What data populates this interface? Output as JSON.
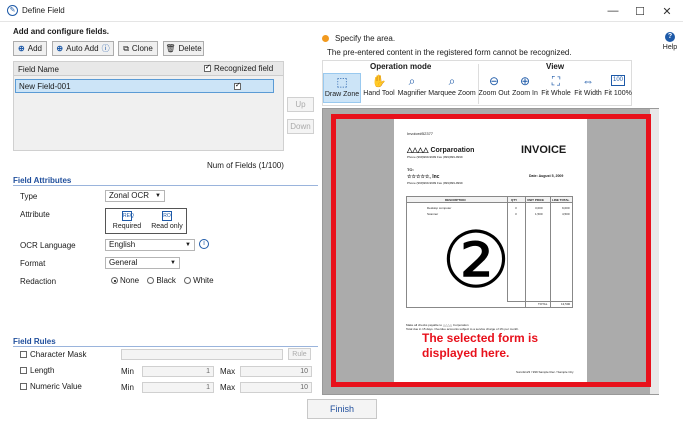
{
  "window": {
    "title": "Define Field"
  },
  "left": {
    "heading": "Add and configure fields.",
    "toolbar": {
      "add": "Add",
      "auto_add": "Auto Add",
      "clone": "Clone",
      "delete": "Delete"
    },
    "table": {
      "col_name": "Field Name",
      "col_recognized": "Recognized field",
      "rows": [
        {
          "name": "New Field-001",
          "recognized": true
        }
      ]
    },
    "up": "Up",
    "down": "Down",
    "num_fields": "Num of Fields (1/100)",
    "attributes": {
      "title": "Field Attributes",
      "type_label": "Type",
      "type_value": "Zonal OCR",
      "attribute_label": "Attribute",
      "required": "Required",
      "read_only": "Read only",
      "ocr_label": "OCR Language",
      "ocr_value": "English",
      "format_label": "Format",
      "format_value": "General",
      "redaction_label": "Redaction",
      "redaction_options": [
        "None",
        "Black",
        "White"
      ],
      "redaction_selected": "None"
    },
    "rules": {
      "title": "Field Rules",
      "character_mask": "Character Mask",
      "rule_button": "Rule",
      "length": "Length",
      "numeric_value": "Numeric Value",
      "min_label": "Min",
      "max_label": "Max",
      "length_min": "1",
      "length_max": "10",
      "numeric_min": "1",
      "numeric_max": "10"
    }
  },
  "right": {
    "info_title": "Specify the area.",
    "info_text": "The pre-entered content in the registered form cannot be recognized.",
    "help": "Help",
    "operation_mode": "Operation mode",
    "view": "View",
    "tools": [
      "Draw Zone",
      "Hand Tool",
      "Magnifier",
      "Marquee Zoom"
    ],
    "view_tools": [
      "Zoom Out",
      "Zoom In",
      "Fit Whole",
      "Fit Width",
      "Fit 100%"
    ],
    "invoice": {
      "number": "Invoice#52377",
      "company": "△△△△ Corparoation",
      "company_phone": "Phone (999)999-9999  Fax (999)999-9999",
      "title": "INVOICE",
      "to_label": "TO:",
      "customer": "☆☆☆☆☆, Inc",
      "customer_phone": "Phone (999)999-9999  Fax (999)999-9999",
      "date": "Date: August 5, 2009",
      "headers": [
        "DESCRIPTION",
        "QTY",
        "UNIT PRICE",
        "LINE TOTAL"
      ],
      "items": [
        [
          "Desktop computer",
          "3",
          "3,000",
          "9,000"
        ],
        [
          "Scanner",
          "3",
          "1,500",
          "4,500"
        ]
      ],
      "total_label": "TOTAL",
      "total_value": "13,500",
      "marker": "②",
      "footer": "Sunnik123 / 999 Sample Rec / Sample City",
      "note_lines": [
        "Make all checks payable to △△△△ Corporation",
        "Total due in 15 days. Overdue accounts subject to a service charge of 1% per month."
      ]
    },
    "callout": "The selected form is displayed here."
  },
  "finish": "Finish",
  "colors": {
    "accent": "#1e5aa8",
    "highlight": "#e8101b",
    "selection": "#cce4f7"
  }
}
